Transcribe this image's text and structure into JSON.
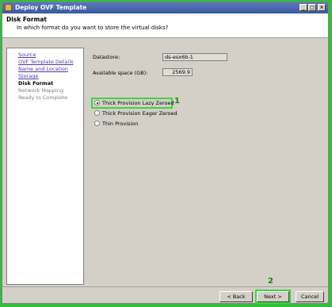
{
  "window": {
    "title": "Deploy OVF Template",
    "min_label": "_",
    "max_label": "□",
    "close_label": "×"
  },
  "header": {
    "title": "Disk Format",
    "subtitle": "In which format do you want to store the virtual disks?"
  },
  "nav": {
    "items": [
      {
        "label": "Source",
        "state": "link"
      },
      {
        "label": "OVF Template Details",
        "state": "link"
      },
      {
        "label": "Name and Location",
        "state": "link"
      },
      {
        "label": "Storage",
        "state": "link"
      },
      {
        "label": "Disk Format",
        "state": "current"
      },
      {
        "label": "Network Mapping",
        "state": "disabled"
      },
      {
        "label": "Ready to Complete",
        "state": "disabled"
      }
    ]
  },
  "form": {
    "datastore_label": "Datastore:",
    "datastore_value": "ds-esx6b-1",
    "space_label": "Available space (GB):",
    "space_value": "2569.9"
  },
  "disk_options": [
    {
      "label": "Thick Provision Lazy Zeroed",
      "selected": true
    },
    {
      "label": "Thick Provision Eager Zeroed",
      "selected": false
    },
    {
      "label": "Thin Provision",
      "selected": false
    }
  ],
  "annotations": {
    "step1": "1",
    "step2": "2"
  },
  "buttons": {
    "back": "< Back",
    "next": "Next >",
    "cancel": "Cancel"
  },
  "colors": {
    "highlight": "#3bd443",
    "annotation_number": "#1e7d16",
    "titlebar": "#3b5aa0",
    "link": "#4a3aa8"
  }
}
